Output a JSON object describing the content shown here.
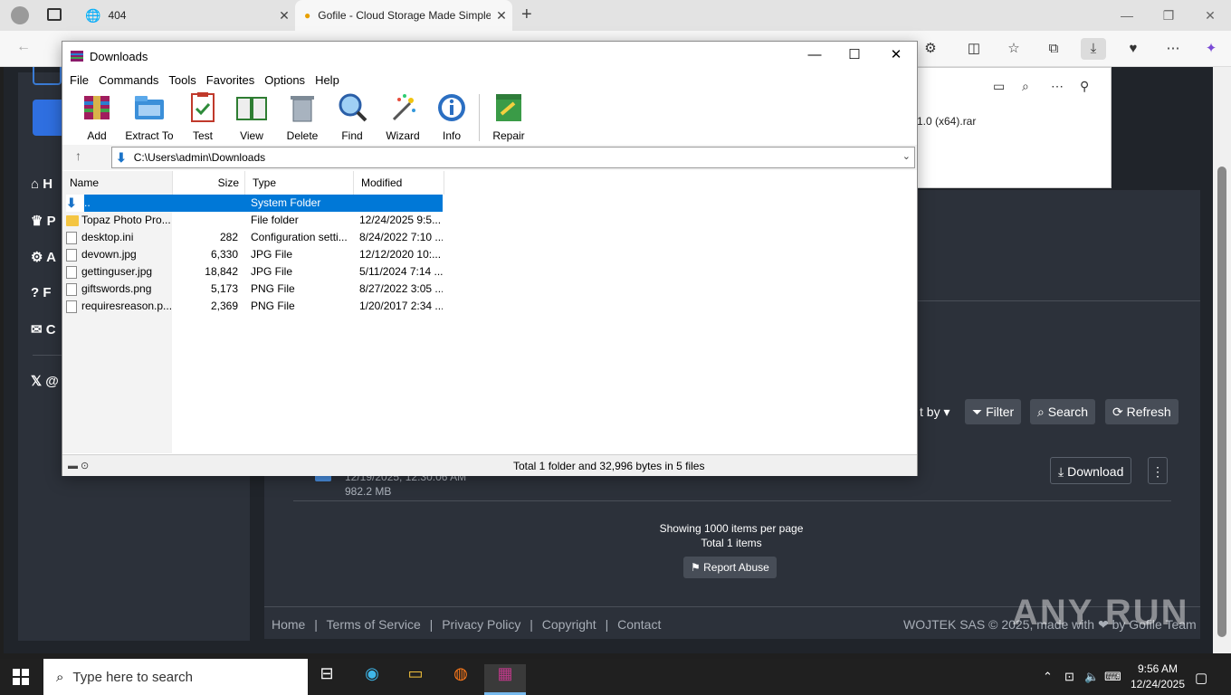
{
  "browser": {
    "tabs": [
      {
        "title": "404"
      },
      {
        "title": "Gofile - Cloud Storage Made Simple"
      }
    ],
    "controls": {
      "minimize": "—",
      "restore": "❐",
      "close": "✕"
    }
  },
  "downloads_flyout": {
    "file_name": "1.0 (x64).rar"
  },
  "site": {
    "sidebar_items": [
      "H",
      "P",
      "A",
      "F",
      "C",
      "@"
    ],
    "toolbar": {
      "sort": "t by",
      "filter": "Filter",
      "search": "Search",
      "refresh": "Refresh"
    },
    "file": {
      "date": "12/19/2025, 12:30:06 AM",
      "size": "982.2 MB",
      "download": "Download"
    },
    "paging": {
      "per_page": "Showing 1000 items per page",
      "total": "Total 1 items",
      "report": "Report Abuse"
    },
    "footer": {
      "links": [
        "Home",
        "|",
        "Terms of Service",
        "|",
        "Privacy Policy",
        "|",
        "Copyright",
        "|",
        "Contact"
      ],
      "copyright": "WOJTEK SAS © 2025, made with ❤ by Gofile Team"
    },
    "watermark": "ANY RUN"
  },
  "winrar": {
    "title": "Downloads",
    "menu": [
      "File",
      "Commands",
      "Tools",
      "Favorites",
      "Options",
      "Help"
    ],
    "tools": [
      {
        "label": "Add",
        "icon": "add-icon"
      },
      {
        "label": "Extract To",
        "icon": "extract-icon"
      },
      {
        "label": "Test",
        "icon": "test-icon"
      },
      {
        "label": "View",
        "icon": "view-icon"
      },
      {
        "label": "Delete",
        "icon": "delete-icon"
      },
      {
        "label": "Find",
        "icon": "find-icon"
      },
      {
        "label": "Wizard",
        "icon": "wizard-icon"
      },
      {
        "label": "Info",
        "icon": "info-icon"
      },
      {
        "label": "Repair",
        "icon": "repair-icon"
      }
    ],
    "path": "C:\\Users\\admin\\Downloads",
    "columns": {
      "name": "Name",
      "size": "Size",
      "type": "Type",
      "modified": "Modified"
    },
    "rows": [
      {
        "name": "..",
        "size": "",
        "type": "System Folder",
        "modified": "",
        "kind": "up"
      },
      {
        "name": "Topaz Photo Pro...",
        "size": "",
        "type": "File folder",
        "modified": "12/24/2025 9:5...",
        "kind": "folder"
      },
      {
        "name": "desktop.ini",
        "size": "282",
        "type": "Configuration setti...",
        "modified": "8/24/2022 7:10 ...",
        "kind": "file"
      },
      {
        "name": "devown.jpg",
        "size": "6,330",
        "type": "JPG File",
        "modified": "12/12/2020 10:...",
        "kind": "file"
      },
      {
        "name": "gettinguser.jpg",
        "size": "18,842",
        "type": "JPG File",
        "modified": "5/11/2024 7:14 ...",
        "kind": "file"
      },
      {
        "name": "giftswords.png",
        "size": "5,173",
        "type": "PNG File",
        "modified": "8/27/2022 3:05 ...",
        "kind": "file"
      },
      {
        "name": "requiresreason.p...",
        "size": "2,369",
        "type": "PNG File",
        "modified": "1/20/2017 2:34 ...",
        "kind": "file"
      }
    ],
    "status": "Total 1 folder and 32,996 bytes in 5 files"
  },
  "taskbar": {
    "search_placeholder": "Type here to search",
    "time": "9:56 AM",
    "date": "12/24/2025"
  },
  "colors": {
    "selection": "#0078d7",
    "site_bg": "#20242a",
    "panel_bg": "#2c313a"
  }
}
